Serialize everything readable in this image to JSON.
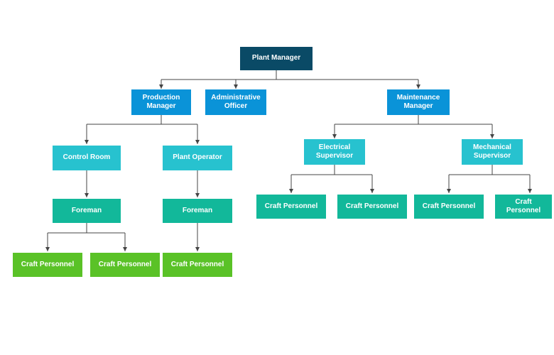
{
  "colors": {
    "level0": "#0a4a66",
    "level1": "#0a93d8",
    "level2": "#27c2cf",
    "level3a": "#12b89a",
    "level3b": "#5ac227",
    "line": "#444"
  },
  "nodes": {
    "root": "Plant Manager",
    "prod_mgr": "Production Manager",
    "admin": "Administrative Officer",
    "maint_mgr": "Maintenance Manager",
    "ctrl_room": "Control Room",
    "plant_op": "Plant Operator",
    "elec_sup": "Electrical Supervisor",
    "mech_sup": "Mechanical Supervisor",
    "foreman1": "Foreman",
    "foreman2": "Foreman",
    "cp1": "Craft Personnel",
    "cp2": "Craft Personnel",
    "cp3": "Craft Personnel",
    "cp4": "Craft Personnel",
    "cp5": "Craft Personnel",
    "cp6": "Craft Personnel",
    "cp7": "Craft Personnel"
  }
}
